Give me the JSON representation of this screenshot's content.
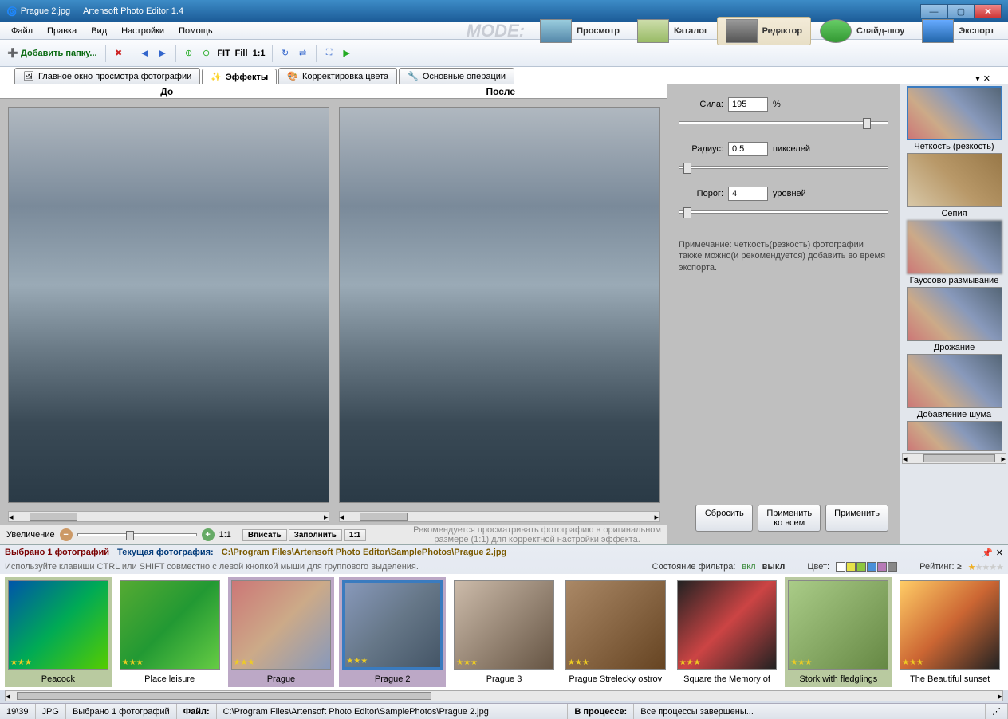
{
  "title": {
    "doc": "Prague 2.jpg",
    "app": "Artensoft Photo Editor 1.4"
  },
  "menu": [
    "Файл",
    "Правка",
    "Вид",
    "Настройки",
    "Помощь"
  ],
  "toolbar": {
    "add_folder": "Добавить папку...",
    "fit": "FIT",
    "fill": "Fill",
    "one": "1:1"
  },
  "mode": {
    "label": "MODE:",
    "items": [
      {
        "label": "Просмотр"
      },
      {
        "label": "Каталог"
      },
      {
        "label": "Редактор",
        "active": true
      },
      {
        "label": "Слайд-шоу"
      },
      {
        "label": "Экспорт"
      }
    ]
  },
  "subtabs": [
    {
      "label": "Главное окно просмотра фотографии"
    },
    {
      "label": "Эффекты",
      "active": true
    },
    {
      "label": "Корректировка цвета"
    },
    {
      "label": "Основные операции"
    }
  ],
  "preview": {
    "before": "До",
    "after": "После"
  },
  "zoom": {
    "label": "Увеличение",
    "one": "1:1",
    "fit": "Вписать",
    "fill": "Заполнить",
    "one2": "1:1",
    "reco1": "Рекомендуется просматривать фотографию в оригинальном",
    "reco2": "размере (1:1) для корректной настройки эффекта."
  },
  "params": {
    "strength_label": "Сила:",
    "strength_val": "195",
    "strength_unit": "%",
    "radius_label": "Радиус:",
    "radius_val": "0.5",
    "radius_unit": "пикселей",
    "threshold_label": "Порог:",
    "threshold_val": "4",
    "threshold_unit": "уровней",
    "note": "Примечание: четкость(резкость) фотографии также можно(и рекомендуется) добавить во время экспорта."
  },
  "actions": {
    "reset": "Сбросить",
    "apply_all": "Применить\nко всем",
    "apply": "Применить"
  },
  "effects": [
    "Четкость (резкость)",
    "Сепия",
    "Гауссово размывание",
    "Дрожание",
    "Добавление шума"
  ],
  "film": {
    "selected": "Выбрано 1  фотографий",
    "current": "Текущая фотография:",
    "path": "C:\\Program Files\\Artensoft Photo Editor\\SamplePhotos\\Prague 2.jpg",
    "hint": "Используйте клавиши CTRL или SHIFT совместно с левой кнопкой мыши для группового выделения.",
    "filter_label": "Состояние фильтра:",
    "filter_on": "вкл",
    "filter_off": "выкл",
    "color_label": "Цвет:",
    "rating_label": "Рейтинг: ≥"
  },
  "thumbs": [
    {
      "title": "Peacock",
      "cls": "green"
    },
    {
      "title": "Place leisure"
    },
    {
      "title": "Prague",
      "cls": "sel"
    },
    {
      "title": "Prague 2",
      "cls": "sel",
      "selected": true
    },
    {
      "title": "Prague 3"
    },
    {
      "title": "Prague Strelecky ostrov"
    },
    {
      "title": "Square the Memory of"
    },
    {
      "title": "Stork with fledglings",
      "cls": "green"
    },
    {
      "title": "The Beautiful sunset"
    }
  ],
  "status": {
    "count": "19\\39",
    "fmt": "JPG",
    "sel": "Выбрано 1 фотографий",
    "file_label": "Файл:",
    "file_path": "C:\\Program Files\\Artensoft Photo Editor\\SamplePhotos\\Prague 2.jpg",
    "proc_label": "В процессе:",
    "proc_val": "Все процессы завершены..."
  },
  "colors": [
    "#ffffff",
    "#e6e24a",
    "#8dc63f",
    "#4a90d9",
    "#b77ab7",
    "#888888"
  ]
}
